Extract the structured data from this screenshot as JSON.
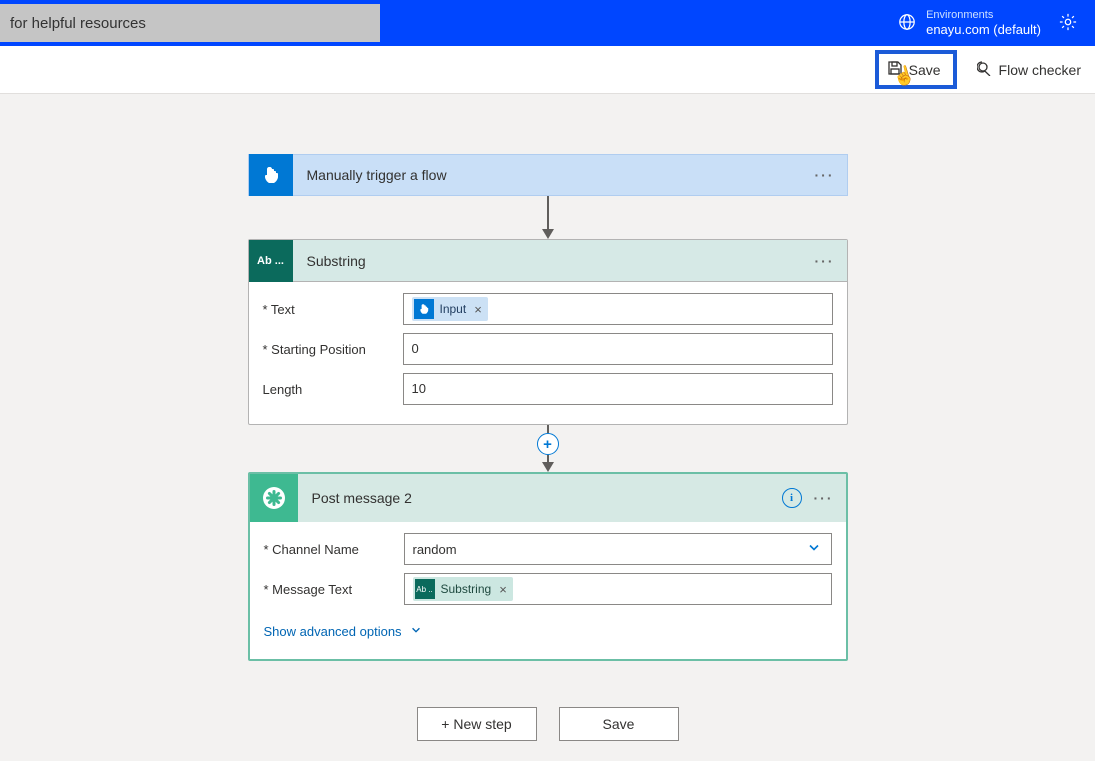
{
  "header": {
    "search_text": "for helpful resources",
    "env_label": "Environments",
    "env_name": "enayu.com (default)"
  },
  "toolbar": {
    "save_label": "Save",
    "checker_label": "Flow checker"
  },
  "cards": {
    "trigger": {
      "title": "Manually trigger a flow"
    },
    "substring": {
      "title": "Substring",
      "icon_text": "Ab ...",
      "fields": {
        "text_label": "* Text",
        "start_label": "* Starting Position",
        "length_label": "Length",
        "start_value": "0",
        "length_value": "10"
      },
      "token": {
        "label": "Input"
      }
    },
    "postmsg": {
      "title": "Post message 2",
      "fields": {
        "channel_label": "* Channel Name",
        "channel_value": "random",
        "msg_label": "* Message Text"
      },
      "token": {
        "icon_text": "Ab ..",
        "label": "Substring"
      },
      "advanced": "Show advanced options"
    }
  },
  "bottom": {
    "new_step": "+ New step",
    "save": "Save"
  }
}
